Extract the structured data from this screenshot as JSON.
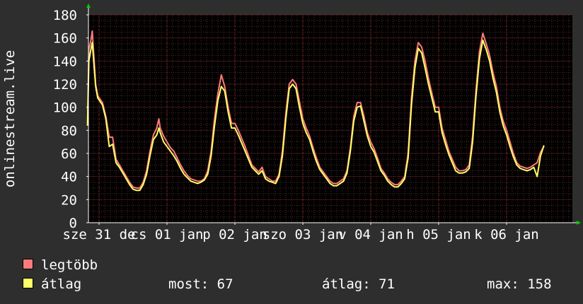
{
  "chart_data": {
    "type": "line",
    "ylabel": "onlinestream.live",
    "ylim": [
      0,
      180
    ],
    "yticks": [
      0,
      20,
      40,
      60,
      80,
      100,
      120,
      140,
      160,
      180
    ],
    "xlim": [
      0,
      7
    ],
    "xticks": [
      {
        "x": 0.0,
        "label": "sze 31 de"
      },
      {
        "x": 1.0,
        "label": "cs 01 jan"
      },
      {
        "x": 2.0,
        "label": "p 02 jan"
      },
      {
        "x": 3.0,
        "label": "szo 03 jan"
      },
      {
        "x": 4.0,
        "label": "v 04 jan"
      },
      {
        "x": 5.0,
        "label": "h 05 jan"
      },
      {
        "x": 6.0,
        "label": "k 06 jan"
      }
    ],
    "grid": true,
    "series": [
      {
        "name": "legtöbb",
        "color": "#ff7b7b",
        "points": [
          [
            -0.17,
            84
          ],
          [
            -0.15,
            150
          ],
          [
            -0.12,
            158
          ],
          [
            -0.1,
            166
          ],
          [
            -0.05,
            120
          ],
          [
            -0.02,
            110
          ],
          [
            0.05,
            104
          ],
          [
            0.1,
            92
          ],
          [
            0.15,
            74
          ],
          [
            0.2,
            74
          ],
          [
            0.25,
            55
          ],
          [
            0.3,
            50
          ],
          [
            0.35,
            45
          ],
          [
            0.4,
            40
          ],
          [
            0.45,
            35
          ],
          [
            0.5,
            31
          ],
          [
            0.55,
            30
          ],
          [
            0.6,
            30
          ],
          [
            0.65,
            35
          ],
          [
            0.7,
            45
          ],
          [
            0.75,
            62
          ],
          [
            0.8,
            76
          ],
          [
            0.85,
            82
          ],
          [
            0.88,
            90
          ],
          [
            0.9,
            82
          ],
          [
            0.95,
            75
          ],
          [
            1.0,
            70
          ],
          [
            1.05,
            65
          ],
          [
            1.1,
            62
          ],
          [
            1.15,
            56
          ],
          [
            1.2,
            50
          ],
          [
            1.25,
            45
          ],
          [
            1.3,
            41
          ],
          [
            1.35,
            38
          ],
          [
            1.4,
            37
          ],
          [
            1.45,
            36
          ],
          [
            1.5,
            36
          ],
          [
            1.55,
            38
          ],
          [
            1.6,
            45
          ],
          [
            1.65,
            62
          ],
          [
            1.7,
            90
          ],
          [
            1.75,
            112
          ],
          [
            1.8,
            128
          ],
          [
            1.85,
            118
          ],
          [
            1.9,
            100
          ],
          [
            1.95,
            86
          ],
          [
            2.0,
            86
          ],
          [
            2.05,
            80
          ],
          [
            2.1,
            73
          ],
          [
            2.15,
            66
          ],
          [
            2.2,
            58
          ],
          [
            2.25,
            50
          ],
          [
            2.3,
            47
          ],
          [
            2.35,
            44
          ],
          [
            2.4,
            48
          ],
          [
            2.45,
            40
          ],
          [
            2.5,
            38
          ],
          [
            2.55,
            36
          ],
          [
            2.6,
            36
          ],
          [
            2.65,
            42
          ],
          [
            2.7,
            62
          ],
          [
            2.75,
            95
          ],
          [
            2.8,
            120
          ],
          [
            2.85,
            124
          ],
          [
            2.9,
            120
          ],
          [
            2.95,
            105
          ],
          [
            3.0,
            90
          ],
          [
            3.05,
            82
          ],
          [
            3.1,
            75
          ],
          [
            3.15,
            65
          ],
          [
            3.2,
            56
          ],
          [
            3.25,
            48
          ],
          [
            3.3,
            44
          ],
          [
            3.35,
            40
          ],
          [
            3.4,
            36
          ],
          [
            3.45,
            34
          ],
          [
            3.5,
            34
          ],
          [
            3.55,
            36
          ],
          [
            3.6,
            38
          ],
          [
            3.65,
            45
          ],
          [
            3.7,
            65
          ],
          [
            3.75,
            92
          ],
          [
            3.8,
            104
          ],
          [
            3.85,
            104
          ],
          [
            3.9,
            92
          ],
          [
            3.95,
            78
          ],
          [
            4.0,
            70
          ],
          [
            4.05,
            64
          ],
          [
            4.1,
            56
          ],
          [
            4.15,
            47
          ],
          [
            4.2,
            43
          ],
          [
            4.25,
            38
          ],
          [
            4.3,
            35
          ],
          [
            4.35,
            33
          ],
          [
            4.4,
            33
          ],
          [
            4.45,
            36
          ],
          [
            4.5,
            40
          ],
          [
            4.55,
            60
          ],
          [
            4.6,
            108
          ],
          [
            4.65,
            140
          ],
          [
            4.7,
            156
          ],
          [
            4.75,
            152
          ],
          [
            4.8,
            140
          ],
          [
            4.85,
            125
          ],
          [
            4.9,
            112
          ],
          [
            4.95,
            100
          ],
          [
            5.0,
            100
          ],
          [
            5.05,
            82
          ],
          [
            5.1,
            72
          ],
          [
            5.15,
            62
          ],
          [
            5.2,
            55
          ],
          [
            5.25,
            48
          ],
          [
            5.3,
            45
          ],
          [
            5.35,
            45
          ],
          [
            5.4,
            46
          ],
          [
            5.45,
            50
          ],
          [
            5.5,
            75
          ],
          [
            5.55,
            115
          ],
          [
            5.6,
            148
          ],
          [
            5.65,
            164
          ],
          [
            5.7,
            155
          ],
          [
            5.75,
            145
          ],
          [
            5.8,
            130
          ],
          [
            5.85,
            118
          ],
          [
            5.9,
            100
          ],
          [
            5.95,
            88
          ],
          [
            6.0,
            80
          ],
          [
            6.05,
            70
          ],
          [
            6.1,
            60
          ],
          [
            6.15,
            52
          ],
          [
            6.2,
            49
          ],
          [
            6.25,
            48
          ],
          [
            6.3,
            47
          ],
          [
            6.35,
            48
          ],
          [
            6.4,
            50
          ],
          [
            6.45,
            52
          ],
          [
            6.5,
            61
          ],
          [
            6.55,
            66
          ]
        ]
      },
      {
        "name": "átlag",
        "color": "#ffff66",
        "points": [
          [
            -0.17,
            84
          ],
          [
            -0.15,
            140
          ],
          [
            -0.12,
            150
          ],
          [
            -0.1,
            156
          ],
          [
            -0.05,
            118
          ],
          [
            -0.02,
            108
          ],
          [
            0.05,
            102
          ],
          [
            0.1,
            90
          ],
          [
            0.15,
            66
          ],
          [
            0.2,
            68
          ],
          [
            0.25,
            52
          ],
          [
            0.3,
            48
          ],
          [
            0.35,
            43
          ],
          [
            0.4,
            38
          ],
          [
            0.45,
            33
          ],
          [
            0.5,
            29
          ],
          [
            0.55,
            28
          ],
          [
            0.6,
            28
          ],
          [
            0.65,
            33
          ],
          [
            0.7,
            42
          ],
          [
            0.75,
            58
          ],
          [
            0.8,
            72
          ],
          [
            0.85,
            76
          ],
          [
            0.88,
            82
          ],
          [
            0.9,
            78
          ],
          [
            0.95,
            70
          ],
          [
            1.0,
            66
          ],
          [
            1.05,
            62
          ],
          [
            1.1,
            58
          ],
          [
            1.15,
            53
          ],
          [
            1.2,
            47
          ],
          [
            1.25,
            42
          ],
          [
            1.3,
            39
          ],
          [
            1.35,
            36
          ],
          [
            1.4,
            35
          ],
          [
            1.45,
            34
          ],
          [
            1.5,
            35
          ],
          [
            1.55,
            37
          ],
          [
            1.6,
            42
          ],
          [
            1.65,
            58
          ],
          [
            1.7,
            84
          ],
          [
            1.75,
            106
          ],
          [
            1.8,
            118
          ],
          [
            1.85,
            114
          ],
          [
            1.9,
            96
          ],
          [
            1.95,
            82
          ],
          [
            2.0,
            82
          ],
          [
            2.05,
            76
          ],
          [
            2.1,
            69
          ],
          [
            2.15,
            62
          ],
          [
            2.2,
            55
          ],
          [
            2.25,
            48
          ],
          [
            2.3,
            45
          ],
          [
            2.35,
            42
          ],
          [
            2.4,
            45
          ],
          [
            2.45,
            38
          ],
          [
            2.5,
            36
          ],
          [
            2.55,
            35
          ],
          [
            2.6,
            34
          ],
          [
            2.65,
            40
          ],
          [
            2.7,
            58
          ],
          [
            2.75,
            90
          ],
          [
            2.8,
            116
          ],
          [
            2.85,
            120
          ],
          [
            2.9,
            116
          ],
          [
            2.95,
            100
          ],
          [
            3.0,
            86
          ],
          [
            3.05,
            78
          ],
          [
            3.1,
            72
          ],
          [
            3.15,
            62
          ],
          [
            3.2,
            53
          ],
          [
            3.25,
            46
          ],
          [
            3.3,
            42
          ],
          [
            3.35,
            38
          ],
          [
            3.4,
            34
          ],
          [
            3.45,
            32
          ],
          [
            3.5,
            32
          ],
          [
            3.55,
            34
          ],
          [
            3.6,
            36
          ],
          [
            3.65,
            43
          ],
          [
            3.7,
            62
          ],
          [
            3.75,
            88
          ],
          [
            3.8,
            100
          ],
          [
            3.85,
            101
          ],
          [
            3.9,
            88
          ],
          [
            3.95,
            75
          ],
          [
            4.0,
            66
          ],
          [
            4.05,
            61
          ],
          [
            4.1,
            53
          ],
          [
            4.15,
            45
          ],
          [
            4.2,
            41
          ],
          [
            4.25,
            36
          ],
          [
            4.3,
            33
          ],
          [
            4.35,
            31
          ],
          [
            4.4,
            31
          ],
          [
            4.45,
            34
          ],
          [
            4.5,
            38
          ],
          [
            4.55,
            56
          ],
          [
            4.6,
            102
          ],
          [
            4.65,
            134
          ],
          [
            4.7,
            151
          ],
          [
            4.75,
            147
          ],
          [
            4.8,
            134
          ],
          [
            4.85,
            120
          ],
          [
            4.9,
            108
          ],
          [
            4.95,
            96
          ],
          [
            5.0,
            96
          ],
          [
            5.05,
            78
          ],
          [
            5.1,
            68
          ],
          [
            5.15,
            59
          ],
          [
            5.2,
            52
          ],
          [
            5.25,
            45
          ],
          [
            5.3,
            43
          ],
          [
            5.35,
            43
          ],
          [
            5.4,
            44
          ],
          [
            5.45,
            47
          ],
          [
            5.5,
            70
          ],
          [
            5.55,
            110
          ],
          [
            5.6,
            142
          ],
          [
            5.65,
            158
          ],
          [
            5.7,
            150
          ],
          [
            5.75,
            140
          ],
          [
            5.8,
            125
          ],
          [
            5.85,
            113
          ],
          [
            5.9,
            96
          ],
          [
            5.95,
            84
          ],
          [
            6.0,
            76
          ],
          [
            6.05,
            66
          ],
          [
            6.1,
            57
          ],
          [
            6.15,
            50
          ],
          [
            6.2,
            47
          ],
          [
            6.25,
            46
          ],
          [
            6.3,
            45
          ],
          [
            6.35,
            46
          ],
          [
            6.4,
            48
          ],
          [
            6.45,
            40
          ],
          [
            6.5,
            58
          ],
          [
            6.55,
            67
          ]
        ]
      }
    ]
  },
  "legend": {
    "items": [
      {
        "label": "legtöbb",
        "color": "#ff7b7b"
      },
      {
        "label": "átlag",
        "color": "#ffff66"
      }
    ]
  },
  "stats": {
    "most": "most: 67",
    "atlag": "átlag: 71",
    "max": "max: 158"
  }
}
